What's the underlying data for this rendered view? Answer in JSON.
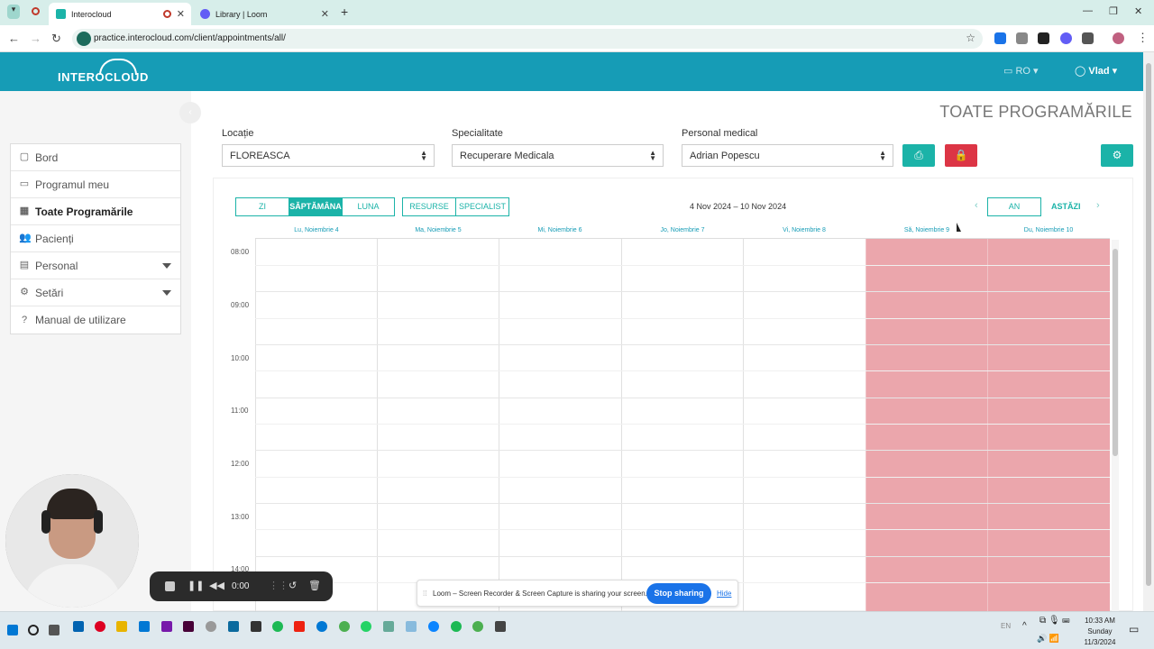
{
  "browser": {
    "tabs": [
      {
        "title": "Interocloud",
        "active": true
      },
      {
        "title": "Library | Loom",
        "active": false
      }
    ],
    "url": "practice.interocloud.com/client/appointments/all/"
  },
  "header": {
    "logo": "INTEROCLOUD",
    "language": "RO",
    "user": "Vlad"
  },
  "sidebar": {
    "items": [
      {
        "label": "Bord",
        "icon": "square-icon"
      },
      {
        "label": "Programul meu",
        "icon": "window-icon"
      },
      {
        "label": "Toate Programările",
        "icon": "calendar-icon",
        "active": true
      },
      {
        "label": "Pacienți",
        "icon": "users-icon"
      },
      {
        "label": "Personal",
        "icon": "clipboard-icon"
      },
      {
        "label": "Setări",
        "icon": "gear-icon"
      },
      {
        "label": "Manual de utilizare",
        "icon": "question-icon"
      }
    ]
  },
  "main": {
    "title": "TOATE PROGRAMĂRILE",
    "filters": {
      "location_label": "Locație",
      "location_value": "FLOREASCA",
      "specialty_label": "Specialitate",
      "specialty_value": "Recuperare Medicala",
      "staff_label": "Personal medical",
      "staff_value": "Adrian Popescu"
    }
  },
  "calendar": {
    "views": [
      "ZI",
      "SĂPTĂMÂNA",
      "LUNA"
    ],
    "active_view": "SĂPTĂMÂNA",
    "modes": [
      "RESURSE",
      "SPECIALIST"
    ],
    "range": "4 Nov 2024 – 10 Nov 2024",
    "year_button": "AN",
    "today_button": "ASTĂZI",
    "days": [
      "Lu, Noiembrie 4",
      "Ma, Noiembrie 5",
      "Mi, Noiembrie 6",
      "Jo, Noiembrie 7",
      "Vi, Noiembrie 8",
      "Să, Noiembrie 9",
      "Du, Noiembrie 10"
    ],
    "times": [
      "08:00",
      "09:00",
      "10:00",
      "11:00",
      "12:00",
      "13:00",
      "14:00"
    ],
    "weekend_color": "#eba6ac"
  },
  "loom": {
    "timer": "0:00",
    "share_text": "Loom – Screen Recorder & Screen Capture is sharing your screen.",
    "stop_sharing": "Stop sharing",
    "hide": "Hide"
  },
  "taskbar": {
    "lang": "EN",
    "time": "10:33 AM",
    "day": "Sunday",
    "date": "11/3/2024"
  },
  "colors": {
    "header": "#169cb6",
    "accent": "#1bb3a8",
    "danger": "#dc3545"
  }
}
